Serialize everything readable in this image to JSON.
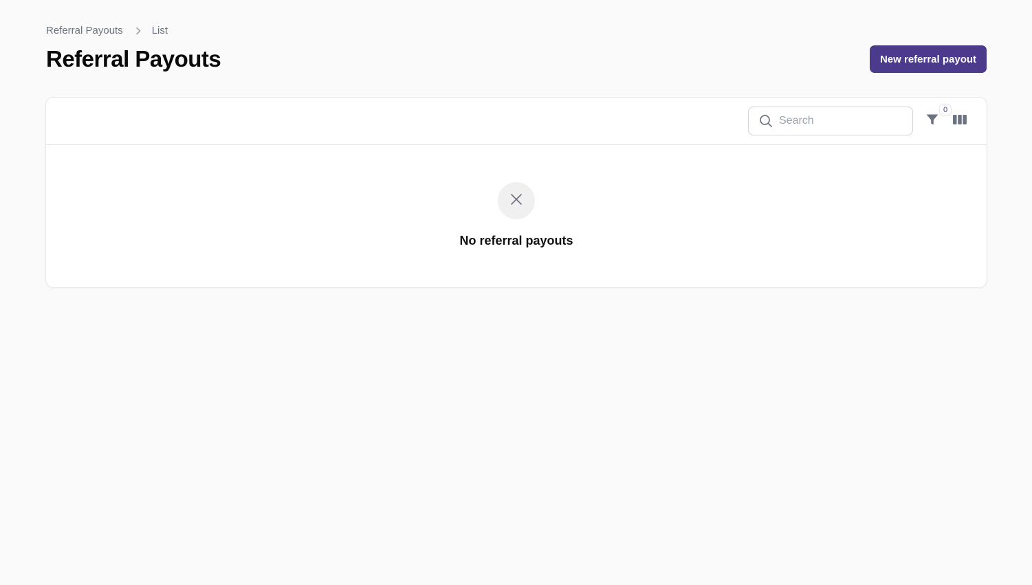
{
  "breadcrumb": {
    "items": [
      {
        "label": "Referral Payouts"
      },
      {
        "label": "List"
      }
    ]
  },
  "header": {
    "title": "Referral Payouts",
    "primary_action_label": "New referral payout"
  },
  "table": {
    "search": {
      "placeholder": "Search",
      "value": ""
    },
    "filter_count": "0",
    "icons": {
      "search": "search-icon",
      "filter": "funnel-icon",
      "columns": "columns-icon",
      "empty": "close-icon"
    },
    "empty_state": {
      "heading": "No referral payouts"
    }
  },
  "colors": {
    "accent": "#4c3a8c",
    "background": "#fafafa",
    "panel": "#ffffff",
    "border": "#e5e7eb",
    "muted_text": "#6b7280"
  }
}
